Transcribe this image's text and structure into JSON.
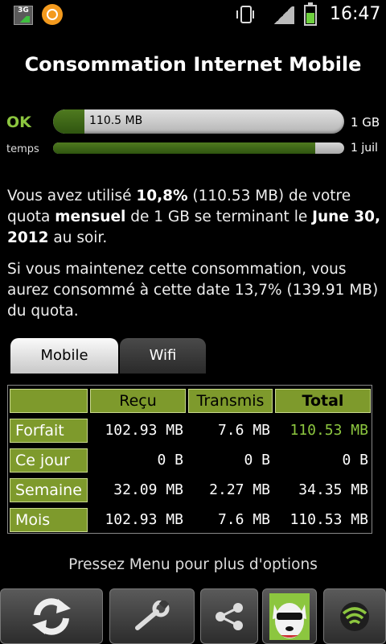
{
  "status_bar": {
    "network_badge": "3G",
    "time": "16:47"
  },
  "title": "Consommation Internet Mobile",
  "usage": {
    "status_label": "OK",
    "used_text": "110.5 MB",
    "quota_label": "1 GB",
    "used_fraction": 0.108
  },
  "time_bar": {
    "label": "temps",
    "end_label": "1 juil",
    "elapsed_fraction": 0.9
  },
  "summary": {
    "p1_a": "Vous avez utilisé ",
    "p1_pct": "10,8%",
    "p1_b": " (110.53 MB) de votre quota ",
    "p1_period": "mensuel",
    "p1_c": " de 1 GB se terminant le ",
    "p1_date": "June 30, 2012",
    "p1_d": " au soir.",
    "p2": "Si vous maintenez cette consommation, vous aurez consommé à cette date 13,7% (139.91 MB) du quota."
  },
  "tabs": {
    "mobile": "Mobile",
    "wifi": "Wifi"
  },
  "table": {
    "headers": {
      "recu": "Reçu",
      "transmis": "Transmis",
      "total": "Total"
    },
    "rows": [
      {
        "label": "Forfait",
        "recu": "102.93 MB",
        "transmis": "7.6 MB",
        "total": "110.53 MB"
      },
      {
        "label": "Ce jour",
        "recu": "0 B",
        "transmis": "0 B",
        "total": "0 B"
      },
      {
        "label": "Semaine",
        "recu": "32.09 MB",
        "transmis": "2.27 MB",
        "total": "34.35 MB"
      },
      {
        "label": "Mois",
        "recu": "102.93 MB",
        "transmis": "7.6 MB",
        "total": "110.53 MB"
      }
    ]
  },
  "hint": "Pressez Menu pour plus d'options",
  "toolbar": {
    "icons": [
      "refresh-icon",
      "wrench-icon",
      "share-icon",
      "dog-app-icon",
      "shield-wifi-icon"
    ]
  },
  "colors": {
    "accent_green": "#8cc63f",
    "header_green": "#7e9a2c",
    "bar_fill": "#3f6a17"
  }
}
